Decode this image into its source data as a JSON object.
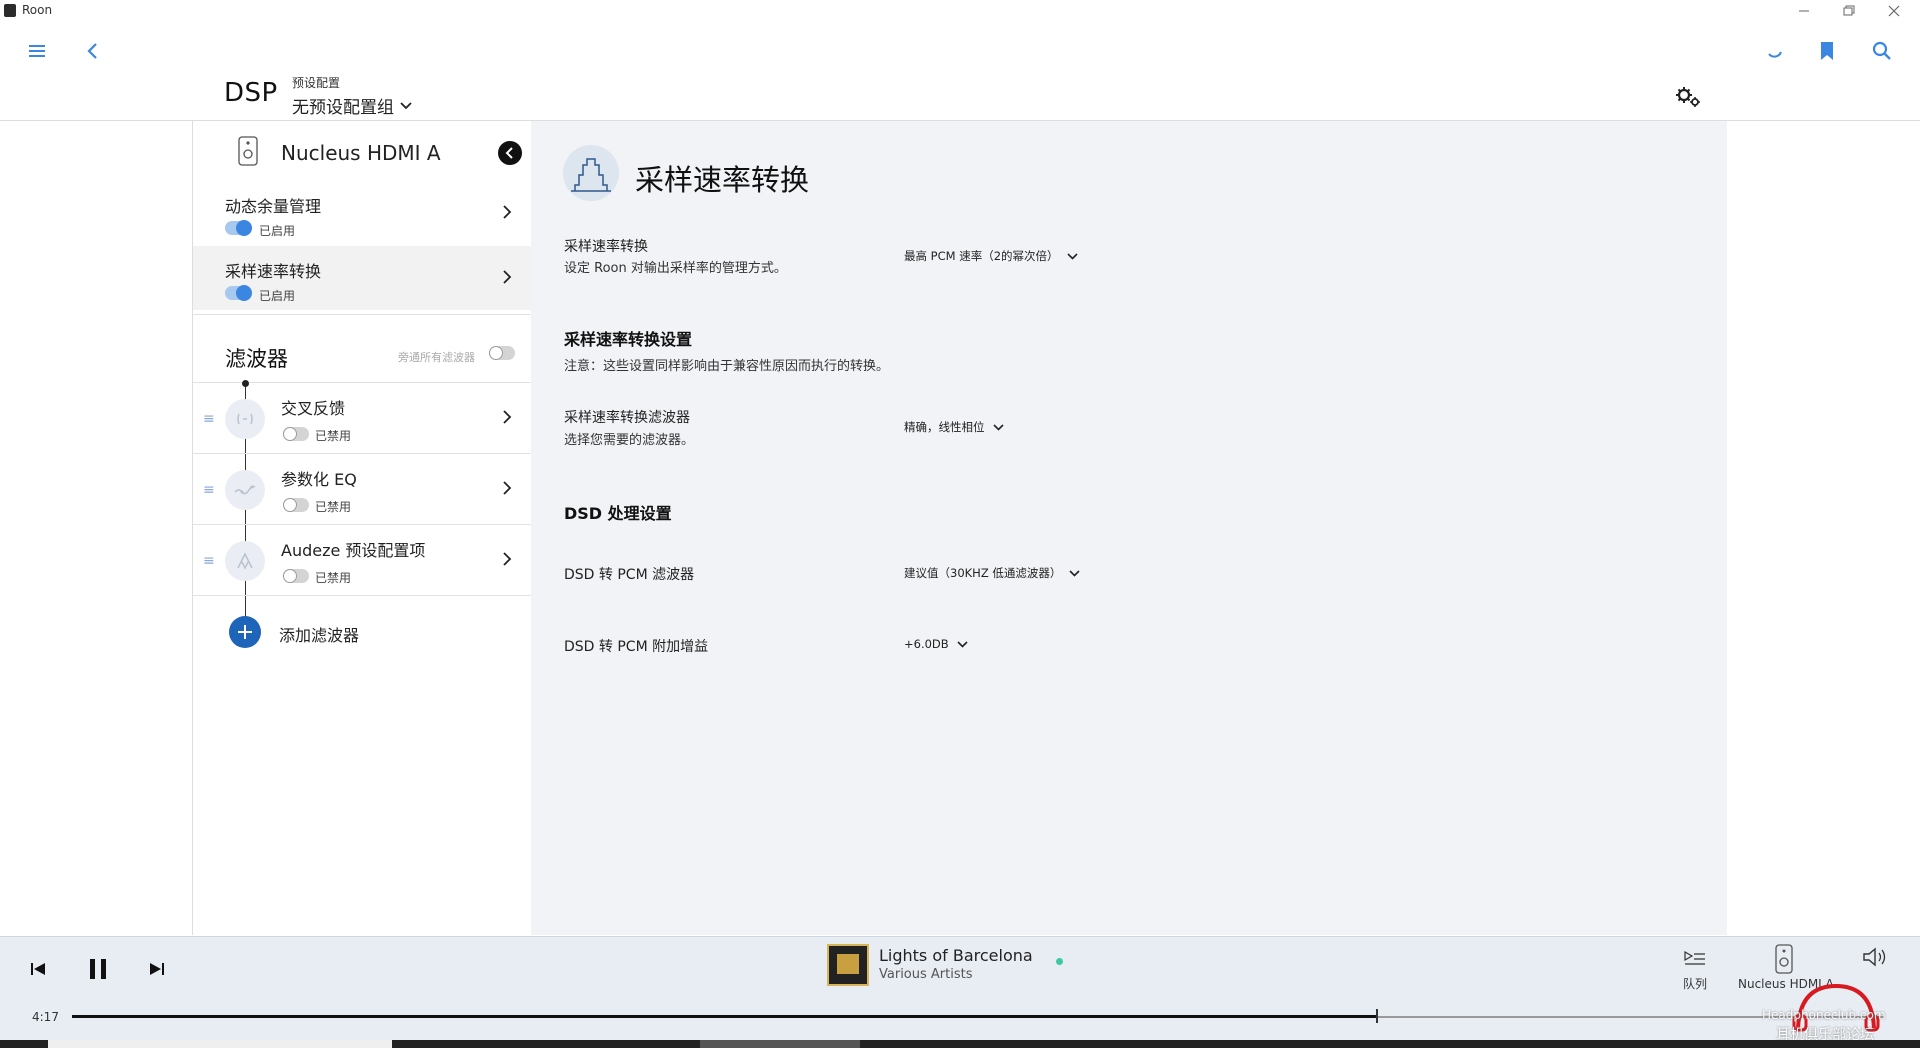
{
  "window": {
    "title": "Roon"
  },
  "header": {
    "title": "DSP",
    "preset_label": "预设配置",
    "preset_value": "无预设配置组"
  },
  "device": {
    "name": "Nucleus HDMI A"
  },
  "dsp_items": [
    {
      "label": "动态余量管理",
      "status": "已启用",
      "enabled": true
    },
    {
      "label": "采样速率转换",
      "status": "已启用",
      "enabled": true,
      "active": true
    }
  ],
  "filters": {
    "title": "滤波器",
    "bypass_label": "旁通所有滤波器",
    "items": [
      {
        "label": "交叉反馈",
        "status": "已禁用",
        "icon": "crossfeed-icon"
      },
      {
        "label": "参数化 EQ",
        "status": "已禁用",
        "icon": "eq-icon"
      },
      {
        "label": "Audeze 预设配置项",
        "status": "已禁用",
        "icon": "audeze-icon"
      }
    ],
    "add_label": "添加滤波器"
  },
  "main": {
    "title": "采样速率转换",
    "src_label": "采样速率转换",
    "src_desc": "设定 Roon 对输出采样率的管理方式。",
    "src_value": "最高 PCM 速率（2的幂次倍）",
    "settings_head": "采样速率转换设置",
    "settings_note": "注意：这些设置同样影响由于兼容性原因而执行的转换。",
    "filter_label": "采样速率转换滤波器",
    "filter_desc": "选择您需要的滤波器。",
    "filter_value": "精确，线性相位",
    "dsd_head": "DSD 处理设置",
    "dsd_filter_label": "DSD 转 PCM 滤波器",
    "dsd_filter_value": "建议值（30KHZ 低通滤波器）",
    "dsd_gain_label": "DSD 转 PCM 附加增益",
    "dsd_gain_value": "+6.0DB"
  },
  "player": {
    "track": "Lights of Barcelona",
    "artist": "Various Artists",
    "elapsed": "4:17",
    "progress_fraction": 0.72,
    "queue_label": "队列",
    "zone_label": "Nucleus HDMI A"
  },
  "watermark": {
    "line1": "Headphoneclub.com",
    "line2": "耳机俱乐部论坛"
  },
  "colors": {
    "accent": "#3a86e0",
    "add_button": "#1e64b8",
    "main_bg": "#f1f3f6",
    "player_bg": "#e8edf3"
  }
}
